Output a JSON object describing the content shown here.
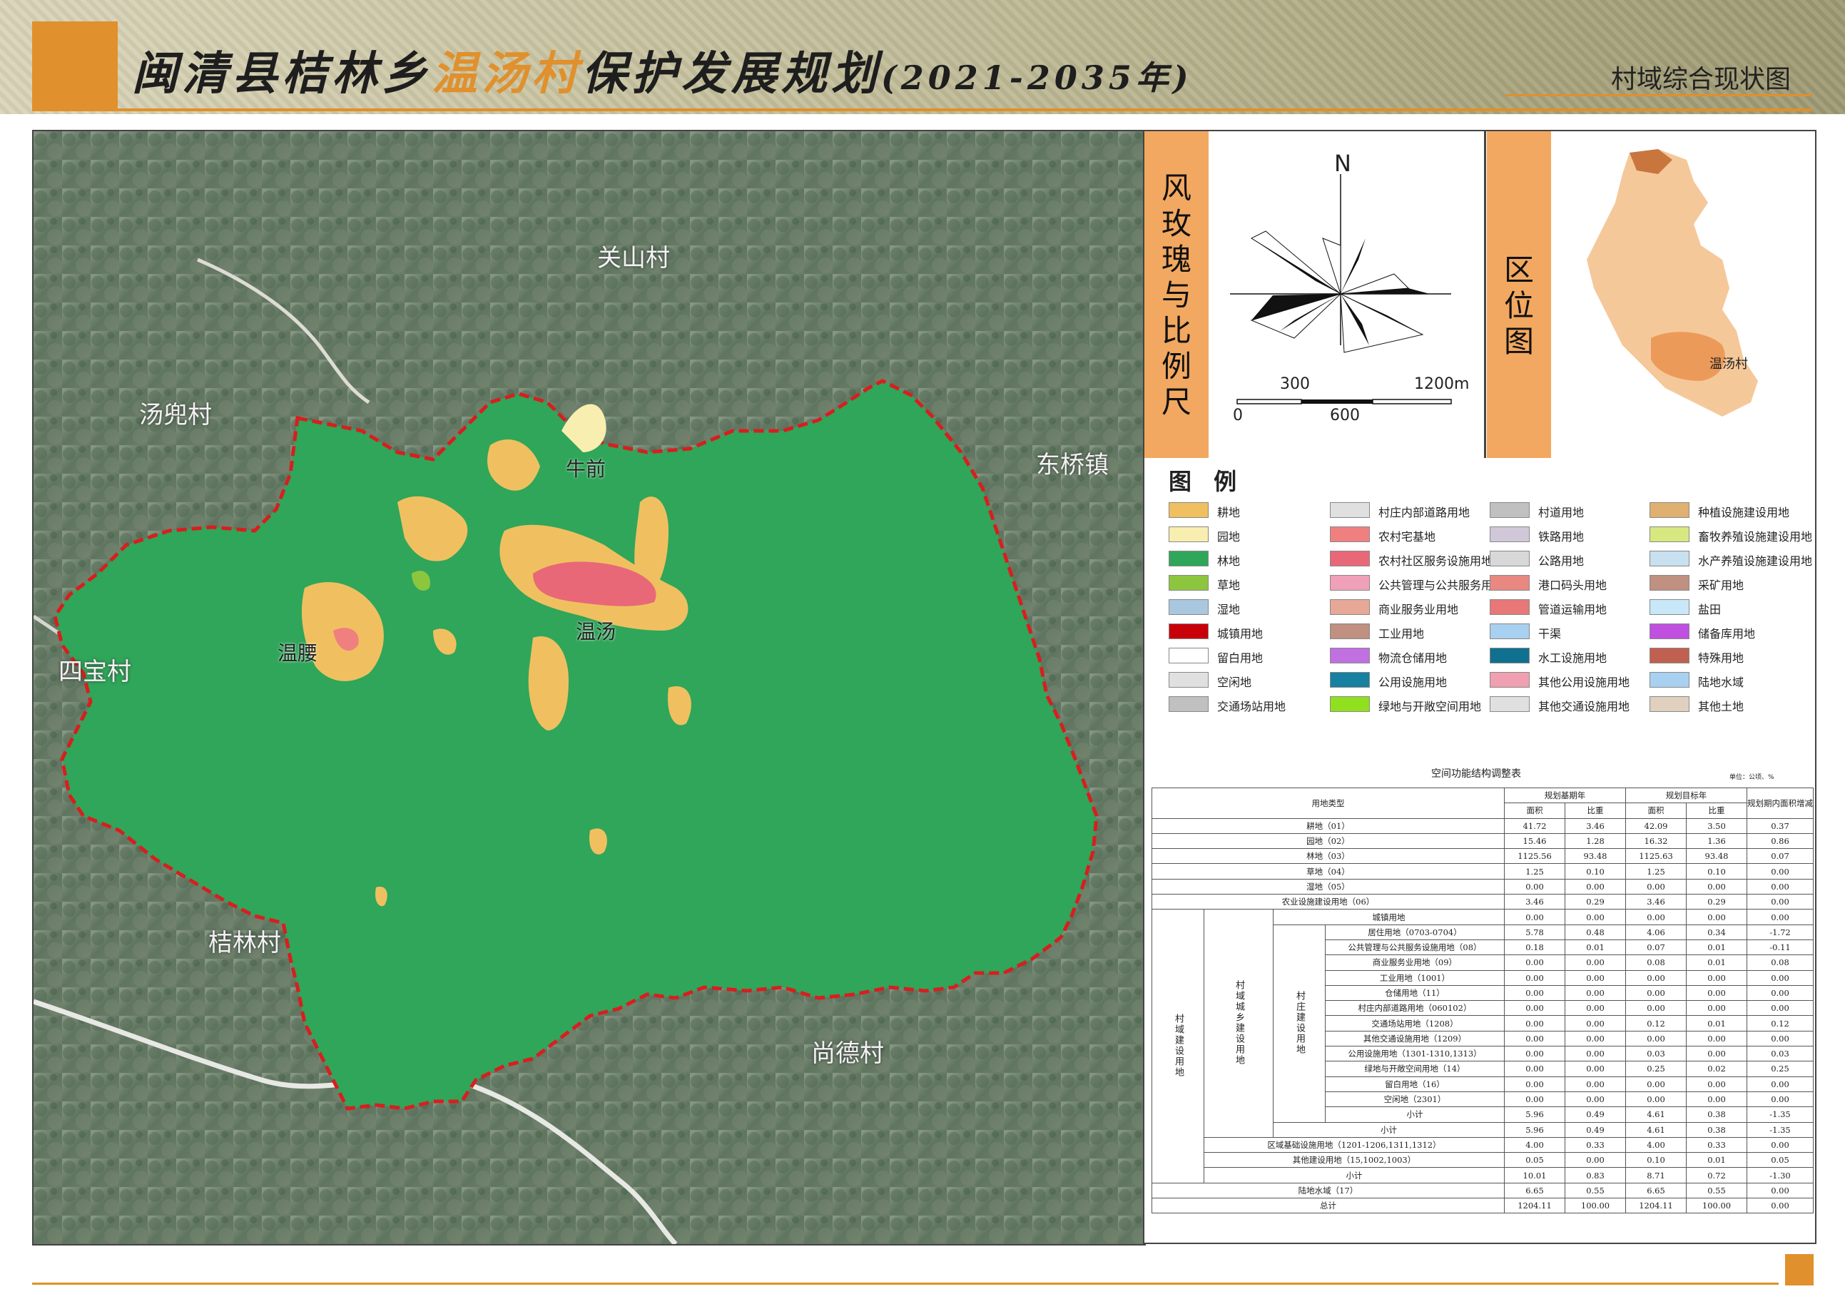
{
  "title": {
    "part1": "闽清县桔林乡",
    "highlight": "温汤村",
    "part2": "保护发展规划",
    "period": "(2021-2035年)"
  },
  "subtitle": "村域综合现状图",
  "map": {
    "places": {
      "guanshan": "关山村",
      "tangdou": "汤兜村",
      "dongqiao": "东桥镇",
      "sibao": "四宝村",
      "julin": "桔林村",
      "shangde": "尚德村",
      "niuqian": "牛前",
      "wentang": "温汤",
      "wenyao": "温腰"
    },
    "boundary_color": "#d81e1e",
    "forest_color": "#2fa65a",
    "farmland_color": "#f0c060"
  },
  "compass": {
    "title_chars": [
      "风",
      "玫",
      "瑰",
      "与",
      "比",
      "例",
      "尺"
    ],
    "north": "N",
    "scale": {
      "l300": "300",
      "l1200": "1200m",
      "l0": "0",
      "l600": "600"
    }
  },
  "location": {
    "title_chars": [
      "区",
      "位",
      "图"
    ],
    "label": "温汤村"
  },
  "legend": {
    "title": "图 例",
    "col1": [
      {
        "label": "耕地",
        "color": "#f0c060"
      },
      {
        "label": "园地",
        "color": "#f8eeb0"
      },
      {
        "label": "林地",
        "color": "#2fa65a"
      },
      {
        "label": "草地",
        "color": "#8cc63f"
      },
      {
        "label": "湿地",
        "color": "#a9c8e0"
      },
      {
        "label": "城镇用地",
        "color": "#c8000a"
      },
      {
        "label": "留白用地",
        "color": "#ffffff"
      },
      {
        "label": "空闲地",
        "color": "#e0e0e0"
      },
      {
        "label": "交通场站用地",
        "color": "#c0c0c0"
      }
    ],
    "col2": [
      {
        "label": "村庄内部道路用地",
        "color": "#e0e0e0"
      },
      {
        "label": "农村宅基地",
        "color": "#f08080"
      },
      {
        "label": "农村社区服务设施用地",
        "color": "#e86878"
      },
      {
        "label": "公共管理与公共服务用地",
        "color": "#f0a0b8"
      },
      {
        "label": "商业服务业用地",
        "color": "#e8a898"
      },
      {
        "label": "工业用地",
        "color": "#c09080"
      },
      {
        "label": "物流仓储用地",
        "color": "#c070e0"
      },
      {
        "label": "公用设施用地",
        "color": "#1880a0"
      },
      {
        "label": "绿地与开敞空间用地",
        "color": "#90e020"
      }
    ],
    "col3": [
      {
        "label": "村道用地",
        "color": "#c0c0c0"
      },
      {
        "label": "铁路用地",
        "color": "#d0c8d8"
      },
      {
        "label": "公路用地",
        "color": "#d8d8d8"
      },
      {
        "label": "港口码头用地",
        "color": "#e88880"
      },
      {
        "label": "管道运输用地",
        "color": "#e87878"
      },
      {
        "label": "干渠",
        "color": "#a8d0f0"
      },
      {
        "label": "水工设施用地",
        "color": "#107090"
      },
      {
        "label": "其他公用设施用地",
        "color": "#f0a0b0"
      },
      {
        "label": "其他交通设施用地",
        "color": "#e0e0e0"
      }
    ],
    "col4": [
      {
        "label": "种植设施建设用地",
        "color": "#e0b070"
      },
      {
        "label": "畜牧养殖设施建设用地",
        "color": "#d8e880"
      },
      {
        "label": "水产养殖设施建设用地",
        "color": "#c8e0f0"
      },
      {
        "label": "采矿用地",
        "color": "#c09080"
      },
      {
        "label": "盐田",
        "color": "#c8e8f8"
      },
      {
        "label": "储备库用地",
        "color": "#c050e0"
      },
      {
        "label": "特殊用地",
        "color": "#c06050"
      },
      {
        "label": "陆地水域",
        "color": "#a8d0f0"
      },
      {
        "label": "其他土地",
        "color": "#e0d0c0"
      }
    ]
  },
  "table": {
    "title": "空间功能结构调整表",
    "unit": "单位：公顷、%",
    "headers": {
      "type": "用地类型",
      "base": "规划基期年",
      "target": "规划目标年",
      "increase": "规划期内面积增减",
      "area": "面积",
      "ratio": "比重"
    },
    "groups": {
      "g1": "村域建设用地",
      "g2": "村域城乡建设用地",
      "g3": "村庄建设用地"
    },
    "rows": [
      {
        "name": "耕地（01）",
        "a1": "41.72",
        "r1": "3.46",
        "a2": "42.09",
        "r2": "3.50",
        "d": "0.37"
      },
      {
        "name": "园地（02）",
        "a1": "15.46",
        "r1": "1.28",
        "a2": "16.32",
        "r2": "1.36",
        "d": "0.86"
      },
      {
        "name": "林地（03）",
        "a1": "1125.56",
        "r1": "93.48",
        "a2": "1125.63",
        "r2": "93.48",
        "d": "0.07"
      },
      {
        "name": "草地（04）",
        "a1": "1.25",
        "r1": "0.10",
        "a2": "1.25",
        "r2": "0.10",
        "d": "0.00"
      },
      {
        "name": "湿地（05）",
        "a1": "0.00",
        "r1": "0.00",
        "a2": "0.00",
        "r2": "0.00",
        "d": "0.00"
      },
      {
        "name": "农业设施建设用地（06）",
        "a1": "3.46",
        "r1": "0.29",
        "a2": "3.46",
        "r2": "0.29",
        "d": "0.00"
      },
      {
        "name": "城镇用地",
        "a1": "0.00",
        "r1": "0.00",
        "a2": "0.00",
        "r2": "0.00",
        "d": "0.00"
      },
      {
        "name": "居住用地（0703-0704）",
        "a1": "5.78",
        "r1": "0.48",
        "a2": "4.06",
        "r2": "0.34",
        "d": "-1.72"
      },
      {
        "name": "公共管理与公共服务设施用地（08）",
        "a1": "0.18",
        "r1": "0.01",
        "a2": "0.07",
        "r2": "0.01",
        "d": "-0.11"
      },
      {
        "name": "商业服务业用地（09）",
        "a1": "0.00",
        "r1": "0.00",
        "a2": "0.08",
        "r2": "0.01",
        "d": "0.08"
      },
      {
        "name": "工业用地（1001）",
        "a1": "0.00",
        "r1": "0.00",
        "a2": "0.00",
        "r2": "0.00",
        "d": "0.00"
      },
      {
        "name": "仓储用地（11）",
        "a1": "0.00",
        "r1": "0.00",
        "a2": "0.00",
        "r2": "0.00",
        "d": "0.00"
      },
      {
        "name": "村庄内部道路用地（060102）",
        "a1": "0.00",
        "r1": "0.00",
        "a2": "0.00",
        "r2": "0.00",
        "d": "0.00"
      },
      {
        "name": "交通场站用地（1208）",
        "a1": "0.00",
        "r1": "0.00",
        "a2": "0.12",
        "r2": "0.01",
        "d": "0.12"
      },
      {
        "name": "其他交通设施用地（1209）",
        "a1": "0.00",
        "r1": "0.00",
        "a2": "0.00",
        "r2": "0.00",
        "d": "0.00"
      },
      {
        "name": "公用设施用地（1301-1310,1313）",
        "a1": "0.00",
        "r1": "0.00",
        "a2": "0.03",
        "r2": "0.00",
        "d": "0.03"
      },
      {
        "name": "绿地与开敞空间用地（14）",
        "a1": "0.00",
        "r1": "0.00",
        "a2": "0.25",
        "r2": "0.02",
        "d": "0.25"
      },
      {
        "name": "留白用地（16）",
        "a1": "0.00",
        "r1": "0.00",
        "a2": "0.00",
        "r2": "0.00",
        "d": "0.00"
      },
      {
        "name": "空闲地（2301）",
        "a1": "0.00",
        "r1": "0.00",
        "a2": "0.00",
        "r2": "0.00",
        "d": "0.00"
      },
      {
        "name": "小计",
        "a1": "5.96",
        "r1": "0.49",
        "a2": "4.61",
        "r2": "0.38",
        "d": "-1.35"
      },
      {
        "name": "小计",
        "a1": "5.96",
        "r1": "0.49",
        "a2": "4.61",
        "r2": "0.38",
        "d": "-1.35"
      },
      {
        "name": "区域基础设施用地（1201-1206,1311,1312）",
        "a1": "4.00",
        "r1": "0.33",
        "a2": "4.00",
        "r2": "0.33",
        "d": "0.00"
      },
      {
        "name": "其他建设用地（15,1002,1003）",
        "a1": "0.05",
        "r1": "0.00",
        "a2": "0.10",
        "r2": "0.01",
        "d": "0.05"
      },
      {
        "name": "小计",
        "a1": "10.01",
        "r1": "0.83",
        "a2": "8.71",
        "r2": "0.72",
        "d": "-1.30"
      },
      {
        "name": "陆地水域（17）",
        "a1": "6.65",
        "r1": "0.55",
        "a2": "6.65",
        "r2": "0.55",
        "d": "0.00"
      },
      {
        "name": "总计",
        "a1": "1204.11",
        "r1": "100.00",
        "a2": "1204.11",
        "r2": "100.00",
        "d": "0.00"
      }
    ]
  }
}
